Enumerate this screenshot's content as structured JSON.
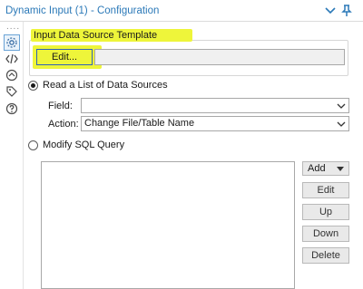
{
  "window": {
    "title": "Dynamic Input (1) - Configuration"
  },
  "rail": {
    "dots": "....",
    "icons": [
      "gear-icon",
      "code-icon",
      "connection-icon",
      "tag-icon",
      "help-icon"
    ]
  },
  "template_group": {
    "title": "Input Data Source Template",
    "edit_label": "Edit...",
    "path_value": ""
  },
  "read_list": {
    "label": "Read a List of Data Sources",
    "checked": true,
    "field_label": "Field:",
    "field_value": "",
    "action_label": "Action:",
    "action_value": "Change File/Table Name"
  },
  "modify_sql": {
    "label": "Modify SQL Query",
    "checked": false,
    "query_text": ""
  },
  "sql_buttons": {
    "add_label": "Add",
    "edit_label": "Edit",
    "up_label": "Up",
    "down_label": "Down",
    "delete_label": "Delete"
  },
  "colors": {
    "highlight": "#eef53a",
    "title_accent": "#2b79b8",
    "focus_border": "#2f62b8"
  }
}
